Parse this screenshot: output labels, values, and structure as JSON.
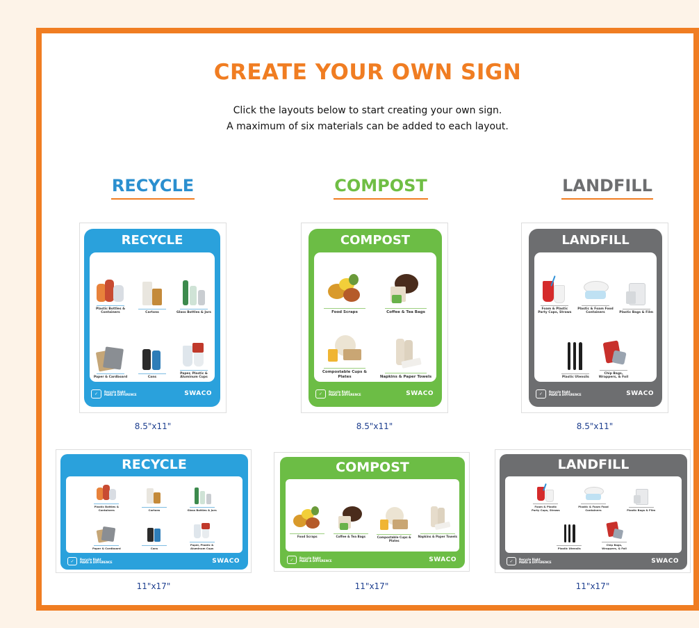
{
  "page": {
    "title": "CREATE YOUR OWN SIGN",
    "intro_line1": "Click the layouts below to start creating your own sign.",
    "intro_line2": "A maximum of six materials can be added to each layout."
  },
  "columns": {
    "recycle": {
      "heading": "RECYCLE",
      "color": "#2b8fcf"
    },
    "compost": {
      "heading": "COMPOST",
      "color": "#6fbe44"
    },
    "landfill": {
      "heading": "LANDFILL",
      "color": "#6d6e70"
    }
  },
  "signs": {
    "recycle": {
      "title": "RECYCLE",
      "items": [
        "Plastic Bottles & Containers",
        "Cartons",
        "Glass Bottles & Jars",
        "Paper & Cardboard",
        "Cans",
        "Paper, Plastic & Aluminum Cups"
      ]
    },
    "compost": {
      "title": "COMPOST",
      "items": [
        "Food Scraps",
        "Coffee & Tea Bags",
        "Compostable Cups & Plates",
        "Napkins & Paper Towels"
      ]
    },
    "landfill": {
      "title": "LANDFILL",
      "items": [
        "Foam & Plastic Party Cups, Straws",
        "Plastic & Foam Food Containers",
        "Plastic Bags & Film",
        "Plastic Utensils",
        "Chip Bags, Wrappers, & Foil"
      ]
    },
    "footer": {
      "tagline_1": "Recycle Right",
      "tagline_2": "MAKE A DIFFERENCE",
      "brand": "SWACO"
    }
  },
  "sizes": {
    "letter": "8.5\"x11\"",
    "tabloid": "11\"x17\""
  },
  "colors": {
    "accent_orange": "#f07d22",
    "recycle_blue": "#2aa1dc",
    "compost_green": "#6cbd45",
    "landfill_gray": "#6d6e70",
    "size_blue": "#1e3f8f"
  }
}
